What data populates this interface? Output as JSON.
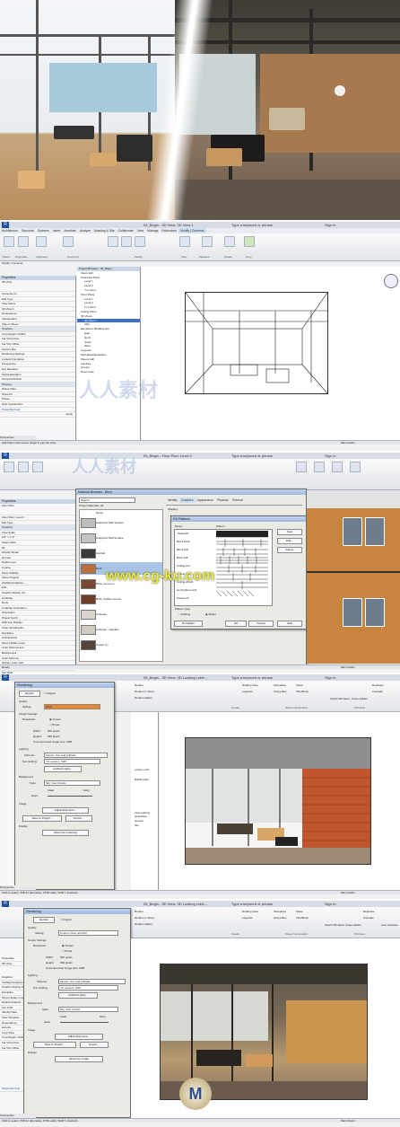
{
  "renders": {
    "sketch_label": "",
    "render_label": ""
  },
  "windows": [
    {
      "title": "02_Begin - 3D View: 3D View 1",
      "search_placeholder": "Type a keyword or phrase",
      "user": "Sign In",
      "tabs": [
        "Architecture",
        "Structure",
        "Systems",
        "Insert",
        "Annotate",
        "Analyze",
        "Massing & Site",
        "Collaborate",
        "View",
        "Manage",
        "Extensions",
        "Modify | Cameras"
      ],
      "active_tab": "Modify | Cameras",
      "ribbon_groups": [
        "Select",
        "Properties",
        "Clipboard",
        "Geometry",
        "Modify",
        "View",
        "Measure",
        "Create",
        "Crop"
      ],
      "breadcrumb": "Modify | Cameras",
      "props_title": "Properties",
      "props_type": "3D View",
      "props_rows": [
        "Cameras (1)",
        "Edit Type",
        "View Name",
        "3D View 1",
        "Dependency",
        "Independent",
        "Title on Sheet",
        "Graphics",
        "Crop Region Visible",
        "Far Clip Active",
        "Far Clip Offset",
        "Section Box",
        "Rendering Settings",
        "Locked Orientation",
        "Perspective",
        "Eye Elevation",
        "Target Elevation",
        "Camera Position",
        "Phasing",
        "Phase Filter",
        "Show All",
        "Phase",
        "New Construction"
      ],
      "props_help": "Properties help",
      "props_apply": "Apply",
      "browser_title": "Project Browser - 02_Begin",
      "browser_items": [
        "Views (all)",
        "Structural Plans",
        "Level 1",
        "Level 2",
        "T.O. Roof",
        "Floor Plans",
        "Level 1",
        "Level 2",
        "T.O. Roof",
        "Ceiling Plans",
        "3D Views",
        "3D View 1",
        "{3D}",
        "Elevations (Building Ele",
        "East",
        "North",
        "South",
        "West",
        "Legends",
        "Schedules/Quantities",
        "Sheets (all)",
        "Families",
        "Groups",
        "Revit Links"
      ],
      "browser_selected": "3D View 1",
      "view_label": "Perspective",
      "status_text": "Add button and mouse wheel to pan the view.",
      "status_model": "Main Model"
    },
    {
      "title": "03_Begin - Floor Plan: Level 2",
      "search_placeholder": "Type a keyword or phrase",
      "user": "Sign In",
      "props_title": "Properties",
      "props_type": "Floor Plan",
      "props_rows": [
        "Floor Plan: Level 2",
        "Edit Type",
        "Graphics",
        "View Scale",
        "1/8\" = 1'-0\"",
        "Scale Value",
        "96",
        "Display Model",
        "Normal",
        "Detail Level",
        "Coarse",
        "Parts Visibility",
        "Show Original",
        "Visibility/Graphics",
        "Edit...",
        "Graphic Display Op",
        "Underlay",
        "None",
        "Underlay Orientation",
        "Orientation",
        "Project North",
        "Wall Join Display",
        "Clean all wall joins",
        "Discipline",
        "Architectural",
        "Show Hidden Lines",
        "Color Scheme Loc",
        "Background",
        "Color Scheme",
        "System Color Sch",
        "Default Analysis",
        "Sun Path",
        "Identity Data",
        "View Template",
        "View Name",
        "Level 2",
        "Dependency",
        "Title on Sheet"
      ],
      "browser_title": "Material Browser - Birch",
      "browser_search": "Search",
      "browser_section": "Project Materials: All",
      "materials": [
        "Name",
        "Analytical Slab Surface",
        "Analytical Wall Surface",
        "Asphalt",
        "Birch",
        "Brick, Common",
        "Brick, Soldier Course",
        "Cabinets",
        "Cabinets - Handles",
        "Carpet (1)"
      ],
      "material_selected": "Birch",
      "asset_tabs": [
        "Identity",
        "Graphics",
        "Appearance",
        "Physical",
        "Thermal"
      ],
      "asset_section": "Shading",
      "fill_dialog_title": "Fill Patterns",
      "fill_header": [
        "Name:",
        "Pattern:"
      ],
      "fill_names": [
        "<Solid fill>",
        "Block 8x16",
        "Block 8x8",
        "Brick 4x8",
        "Ceiling 2x2",
        "Ceiling 2x4",
        "Ceiling 24x24",
        "Herringbone 2x6",
        "Parquet 6\""
      ],
      "fill_buttons": [
        "New",
        "Edit...",
        "Delete"
      ],
      "pattern_type_label": "Pattern Type",
      "pattern_type_options": [
        "Drafting",
        "Model"
      ],
      "fill_footer": [
        "No Pattern",
        "OK",
        "Cancel",
        "Help"
      ],
      "status_text": "Ready",
      "status_model": "Main Model"
    },
    {
      "title": "05_Begin - 3D View: 3D Looking Lobb...",
      "search_placeholder": "Type a keyword or phrase",
      "user": "Sign In",
      "ribbon_items": [
        "Render",
        "Render in Cloud",
        "Render Gallery",
        "Drafting View",
        "Legends",
        "Schedules",
        "Scope Box",
        "Sheet",
        "Title Block",
        "Switch Windows",
        "Close Hidden",
        "Replicate",
        "Cascade"
      ],
      "ribbon_groups": [
        "Create",
        "Sheet Composition",
        "Windows"
      ],
      "dialog_title": "Rendering",
      "render_btn": "Render",
      "region_label": "Region",
      "quality_label": "Quality",
      "setting_label": "Setting:",
      "setting_value": "Draft",
      "output_label": "Output Settings",
      "resolution_label": "Resolution:",
      "res_options": [
        "Screen",
        "Printer"
      ],
      "width_label": "Width:",
      "width_value": "600 pixels",
      "height_label": "Height:",
      "height_value": "399 pixels",
      "uncompressed": "Uncompressed image size: 1MB",
      "lighting_label": "Lighting",
      "scheme_label": "Scheme:",
      "scheme_value": "Interior: Sun and Artificial",
      "sun_label": "Sun Setting:",
      "sun_value": "<In-session, Still>",
      "artificial_label": "Artificial Lights...",
      "background_label": "Background",
      "style_label": "Style:",
      "style_value": "Sky: Few Clouds",
      "clear_label": "Clear",
      "hazy_label": "Hazy",
      "haze_label": "Haze:",
      "image_label": "Image",
      "adjust_exposure": "Adjust Exposure...",
      "save_project": "Save to Project...",
      "export": "Export...",
      "display_label": "Display",
      "show_rendering": "Show the rendering",
      "browser_items": [
        "ooking Lobb",
        "Building Ele",
        "tural Lighting",
        "Quantities",
        "Groups",
        "nks"
      ],
      "view_label": "Perspective",
      "status_text": "Click to select, TAB for alternates, CTRL adds, SHIFT unselects.",
      "status_model": "Main Model"
    },
    {
      "title": "05_Begin - 3D View: 3D Looking Lobb...",
      "search_placeholder": "Type a keyword or phrase",
      "user": "Sign In",
      "ribbon_items": [
        "Render",
        "Render in Cloud",
        "Render Gallery",
        "Drafting View",
        "Legends",
        "Schedules",
        "Scope Box",
        "Sheet",
        "Title Block",
        "Switch Windows",
        "Close Hidden",
        "Replicate",
        "Cascade",
        "User Interface"
      ],
      "ribbon_groups": [
        "Create",
        "Sheet Composition",
        "Windows"
      ],
      "dialog_title": "Rendering",
      "render_btn": "Render",
      "region_label": "Region",
      "quality_label": "Quality",
      "setting_label": "Setting:",
      "setting_value": "Custom (view specific)",
      "output_label": "Output Settings",
      "resolution_label": "Resolution:",
      "res_options": [
        "Screen",
        "Printer"
      ],
      "width_label": "Width:",
      "width_value": "600 pixels",
      "height_label": "Height:",
      "height_value": "399 pixels",
      "uncompressed": "Uncompressed image size: 1MB",
      "lighting_label": "Lighting",
      "scheme_label": "Scheme:",
      "scheme_value": "Interior: Sun and Artificial",
      "sun_label": "Sun Setting:",
      "sun_value": "<In-session, Still>",
      "artificial_label": "Artificial Lights...",
      "background_label": "Background",
      "style_label": "Style:",
      "style_value": "Sky: Few Clouds",
      "clear_label": "Clear",
      "hazy_label": "Hazy",
      "haze_label": "Haze:",
      "image_label": "Image",
      "adjust_exposure": "Adjust Exposure...",
      "save_project": "Save to Project...",
      "export": "Export...",
      "display_label": "Display",
      "show_model": "Show the model",
      "props_rows": [
        "Properties",
        "3D View",
        "Graphics",
        "Visibility/Graphics",
        "Graphic Display Op",
        "Discipline",
        "Show Hidden Lines",
        "Default Analysis",
        "Sun Path",
        "Identity Data",
        "View Template",
        "Dependency",
        "Extents",
        "Crop View",
        "Crop Region Visible",
        "Far Clip Active",
        "Far Clip Offset",
        "Properties help"
      ],
      "view_label": "Perspective",
      "status_text": "Click to select, TAB for alternates, CTRL adds, SHIFT unselects.",
      "status_model": "Main Model"
    }
  ],
  "watermarks": {
    "cn": "人人素材",
    "cg": "www.cg-ku.com",
    "mark": "M"
  },
  "colors": {
    "revit_blue": "#1f4e9c",
    "selection": "#3b6fc9",
    "brick": "#c0562b",
    "titlebar": "#d7dde6"
  }
}
